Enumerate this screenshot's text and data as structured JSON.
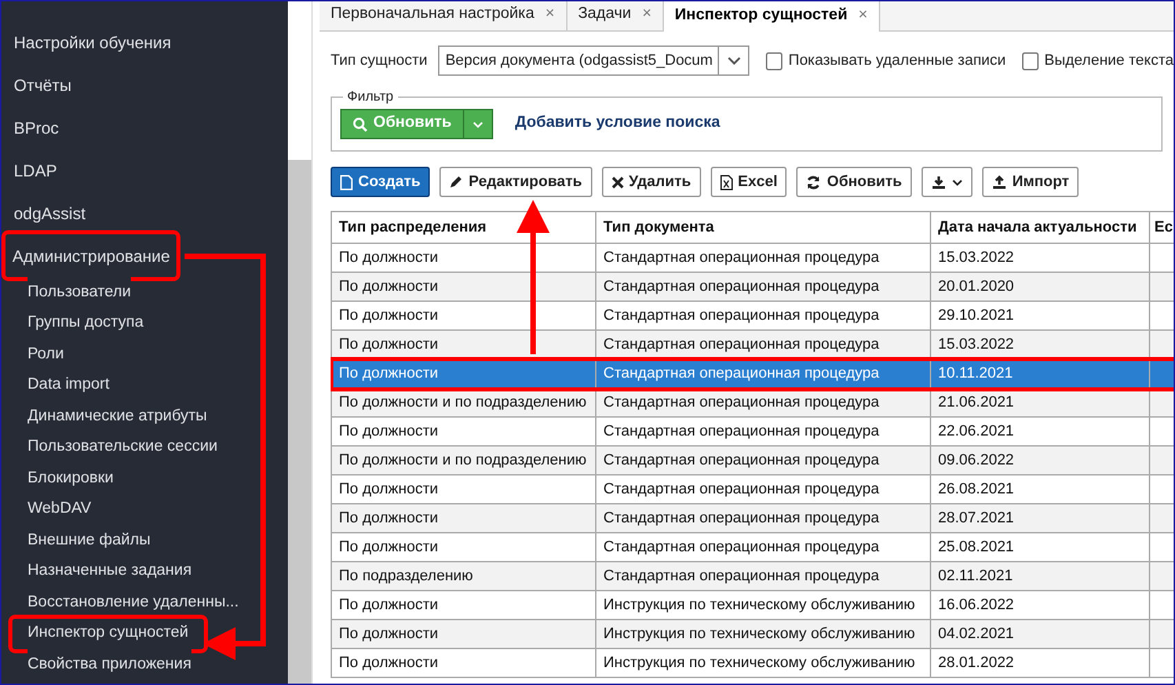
{
  "sidebar": {
    "items": [
      {
        "label": "Настройки обучения",
        "highlighted": false
      },
      {
        "label": "Отчёты",
        "highlighted": false
      },
      {
        "label": "BProc",
        "highlighted": false
      },
      {
        "label": "LDAP",
        "highlighted": false
      },
      {
        "label": "odgAssist",
        "highlighted": false
      },
      {
        "label": "Администрирование",
        "highlighted": true,
        "children": [
          {
            "label": "Пользователи",
            "highlighted": false
          },
          {
            "label": "Группы доступа",
            "highlighted": false
          },
          {
            "label": "Роли",
            "highlighted": false
          },
          {
            "label": "Data import",
            "highlighted": false
          },
          {
            "label": "Динамические атрибуты",
            "highlighted": false
          },
          {
            "label": "Пользовательские сессии",
            "highlighted": false
          },
          {
            "label": "Блокировки",
            "highlighted": false
          },
          {
            "label": "WebDAV",
            "highlighted": false
          },
          {
            "label": "Внешние файлы",
            "highlighted": false
          },
          {
            "label": "Назначенные задания",
            "highlighted": false
          },
          {
            "label": "Восстановление удаленны...",
            "highlighted": false
          },
          {
            "label": "Инспектор сущностей",
            "highlighted": true
          },
          {
            "label": "Свойства приложения",
            "highlighted": false
          }
        ]
      }
    ]
  },
  "tabs": [
    {
      "label": "Первоначальная настройка",
      "close": "×",
      "selected": false
    },
    {
      "label": "Задачи",
      "close": "×",
      "selected": false
    },
    {
      "label": "Инспектор сущностей",
      "close": "×",
      "selected": true
    }
  ],
  "entity_type": {
    "label": "Тип сущности",
    "value": "Версия документа (odgassist5_Docum"
  },
  "checkboxes": [
    {
      "label": "Показывать удаленные записи",
      "checked": false
    },
    {
      "label": "Выделение текста",
      "checked": false
    }
  ],
  "filter": {
    "legend": "Фильтр",
    "refresh_button": "Обновить",
    "add_condition_link": "Добавить условие поиска"
  },
  "toolbar": [
    {
      "label": "Создать",
      "kind": "create",
      "primary": true
    },
    {
      "label": "Редактировать",
      "kind": "edit",
      "primary": false
    },
    {
      "label": "Удалить",
      "kind": "delete",
      "primary": false
    },
    {
      "label": "Excel",
      "kind": "excel",
      "primary": false
    },
    {
      "label": "Обновить",
      "kind": "refresh",
      "primary": false
    },
    {
      "kind": "download",
      "primary": false
    },
    {
      "label": "Импорт",
      "kind": "import",
      "primary": false
    }
  ],
  "table": {
    "columns": [
      "Тип распределения",
      "Тип документа",
      "Дата начала актуальности",
      "Ес"
    ],
    "rows": [
      {
        "cells": [
          "По должности",
          "Стандартная операционная процедура",
          "15.03.2022"
        ],
        "selected": false,
        "highlighted": false
      },
      {
        "cells": [
          "По должности",
          "Стандартная операционная процедура",
          "20.01.2020"
        ],
        "selected": false,
        "highlighted": false
      },
      {
        "cells": [
          "По должности",
          "Стандартная операционная процедура",
          "29.10.2021"
        ],
        "selected": false,
        "highlighted": false
      },
      {
        "cells": [
          "По должности",
          "Стандартная операционная процедура",
          "15.03.2022"
        ],
        "selected": false,
        "highlighted": false
      },
      {
        "cells": [
          "По должности",
          "Стандартная операционная процедура",
          "10.11.2021"
        ],
        "selected": true,
        "highlighted": true
      },
      {
        "cells": [
          "По должности и по подразделению",
          "Стандартная операционная процедура",
          "21.06.2021"
        ],
        "selected": false,
        "highlighted": false
      },
      {
        "cells": [
          "По должности",
          "Стандартная операционная процедура",
          "22.06.2021"
        ],
        "selected": false,
        "highlighted": false
      },
      {
        "cells": [
          "По должности и по подразделению",
          "Стандартная операционная процедура",
          "09.06.2022"
        ],
        "selected": false,
        "highlighted": false
      },
      {
        "cells": [
          "По должности",
          "Стандартная операционная процедура",
          "26.08.2021"
        ],
        "selected": false,
        "highlighted": false
      },
      {
        "cells": [
          "По должности",
          "Стандартная операционная процедура",
          "28.07.2021"
        ],
        "selected": false,
        "highlighted": false
      },
      {
        "cells": [
          "По должности",
          "Стандартная операционная процедура",
          "25.08.2021"
        ],
        "selected": false,
        "highlighted": false
      },
      {
        "cells": [
          "По подразделению",
          "Стандартная операционная процедура",
          "02.11.2021"
        ],
        "selected": false,
        "highlighted": false
      },
      {
        "cells": [
          "По должности",
          "Инструкция по техническому обслуживанию",
          "16.06.2022"
        ],
        "selected": false,
        "highlighted": false
      },
      {
        "cells": [
          "По должности",
          "Инструкция по техническому обслуживанию",
          "04.02.2021"
        ],
        "selected": false,
        "highlighted": false
      },
      {
        "cells": [
          "По должности",
          "Инструкция по техническому обслуживанию",
          "28.01.2022"
        ],
        "selected": false,
        "highlighted": false
      }
    ]
  }
}
